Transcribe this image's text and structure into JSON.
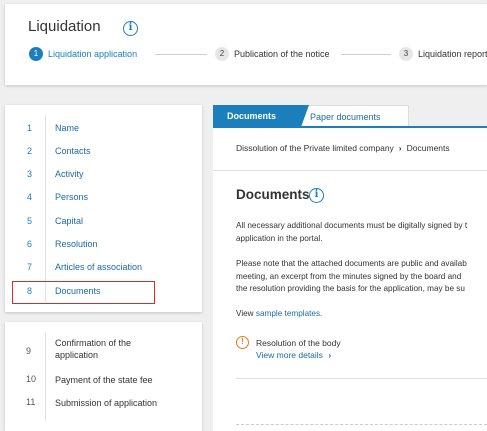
{
  "header": {
    "title": "Liquidation",
    "steps": [
      {
        "num": "1",
        "label": "Liquidation application"
      },
      {
        "num": "2",
        "label": "Publication of the notice"
      },
      {
        "num": "3",
        "label": "Liquidation report"
      }
    ]
  },
  "sidebar": {
    "items": [
      {
        "num": "1",
        "label": "Name"
      },
      {
        "num": "2",
        "label": "Contacts"
      },
      {
        "num": "3",
        "label": "Activity"
      },
      {
        "num": "4",
        "label": "Persons"
      },
      {
        "num": "5",
        "label": "Capital"
      },
      {
        "num": "6",
        "label": "Resolution"
      },
      {
        "num": "7",
        "label": "Articles of association"
      },
      {
        "num": "8",
        "label": "Documents"
      }
    ],
    "later_items": [
      {
        "num": "9",
        "label_line1": "Confirmation of the",
        "label_line2": "application"
      },
      {
        "num": "10",
        "label": "Payment of the state fee"
      },
      {
        "num": "11",
        "label": "Submission of application"
      }
    ]
  },
  "tabs": {
    "active": "Documents",
    "inactive": "Paper documents"
  },
  "main": {
    "breadcrumb_parent": "Dissolution of the Private limited company",
    "breadcrumb_sep": "›",
    "breadcrumb_current": "Documents",
    "heading": "Documents",
    "para1_line1": "All necessary additional documents must be digitally signed by t",
    "para1_line2": "application in the portal.",
    "para2_line1": "Please note that the attached documents are public and availab",
    "para2_line2": "meeting, an excerpt from the minutes signed by the board and",
    "para2_line3": "the resolution providing the basis for the application, may be su",
    "view_prefix": "View ",
    "view_link": "sample templates",
    "view_suffix": ".",
    "warning_title": "Resolution of the body",
    "warning_link": "View more details",
    "warning_link_arrow": "›"
  },
  "colors": {
    "accent": "#1b7fbd",
    "highlight": "#d32f2f",
    "warning": "#e07b1a"
  },
  "icons": {
    "info": "info-circle-icon",
    "warning": "exclamation-circle-icon",
    "chevron": "chevron-right-icon"
  }
}
